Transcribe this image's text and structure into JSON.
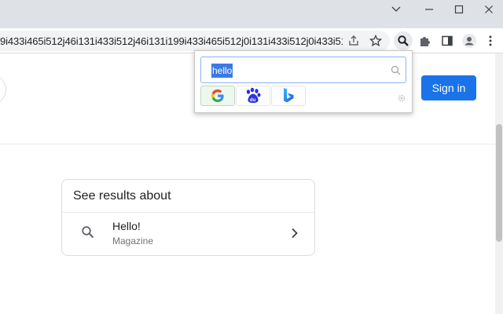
{
  "browser": {
    "url": "9i433i465i512j46i131i433i512j46i131i199i433i465i512j0i131i433i512j0i433i512...",
    "icons": [
      "share-icon",
      "star-icon",
      "search-extension-icon",
      "puzzle-icon",
      "side-panel-icon",
      "profile-icon",
      "menu-icon"
    ]
  },
  "window_controls": [
    "minimize",
    "maximize",
    "close"
  ],
  "page": {
    "sign_in_label": "Sign in",
    "results_card": {
      "heading": "See results about",
      "item_title": "Hello!",
      "item_subtitle": "Magazine"
    }
  },
  "popup": {
    "query": "hello",
    "engines": [
      {
        "name": "Google",
        "icon": "google-logo-icon",
        "active": true
      },
      {
        "name": "Baidu",
        "icon": "baidu-logo-icon",
        "active": false
      },
      {
        "name": "Bing",
        "icon": "bing-logo-icon",
        "active": false
      }
    ]
  },
  "colors": {
    "accent": "#1a73e8",
    "selection": "#3b7ae5",
    "titlebar": "#dee1e6"
  }
}
